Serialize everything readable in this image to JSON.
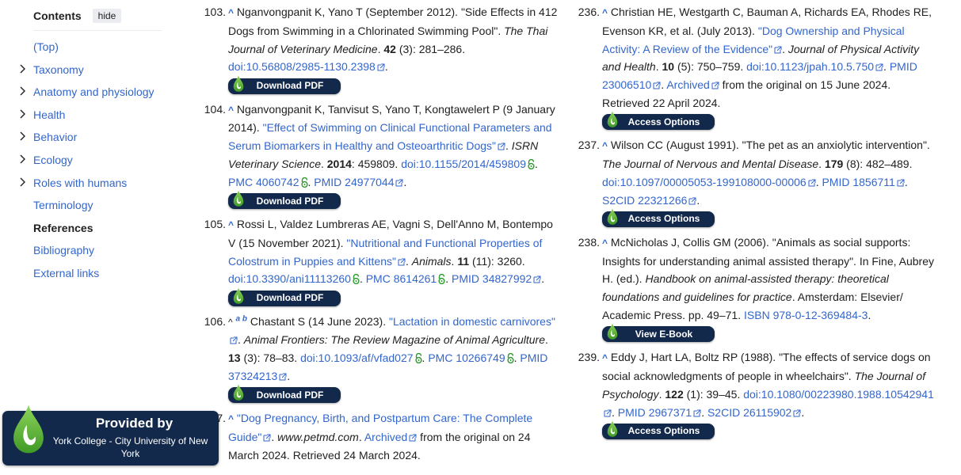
{
  "toc": {
    "title": "Contents",
    "hide_label": "hide",
    "items": [
      {
        "label": "(Top)",
        "expandable": false,
        "active": false
      },
      {
        "label": "Taxonomy",
        "expandable": true,
        "active": false
      },
      {
        "label": "Anatomy and physiology",
        "expandable": true,
        "active": false
      },
      {
        "label": "Health",
        "expandable": true,
        "active": false
      },
      {
        "label": "Behavior",
        "expandable": true,
        "active": false
      },
      {
        "label": "Ecology",
        "expandable": true,
        "active": false
      },
      {
        "label": "Roles with humans",
        "expandable": true,
        "active": false
      },
      {
        "label": "Terminology",
        "expandable": false,
        "active": false
      },
      {
        "label": "References",
        "expandable": false,
        "active": true
      },
      {
        "label": "Bibliography",
        "expandable": false,
        "active": false
      },
      {
        "label": "External links",
        "expandable": false,
        "active": false
      }
    ]
  },
  "references": {
    "r103": {
      "num": "103.",
      "caret": "^",
      "t1": "Nganvongpanit K, Yano T (September 2012). \"Side Effects in 412 Dogs from Swimming in a Chlorinated Swimming Pool\". ",
      "journal": "The Thai Journal of Veterinary Medicine",
      "vol": "42",
      "rest": " (3): 281–286.",
      "doi": "doi:10.56808/2985-1130.2398",
      "button": "Download PDF"
    },
    "r104": {
      "num": "104.",
      "caret": "^",
      "t1": "Nganvongpanit K, Tanvisut S, Yano T, Kongtawelert P (9 January 2014). ",
      "title": "\"Effect of Swimming on Clinical Functional Parameters and Serum Biomarkers in Healthy and Osteoarthritic Dogs\"",
      "journal": "ISRN Veterinary Science",
      "vol": "2014",
      "rest": ": 459809.",
      "doi": "doi:10.1155/2014/459809",
      "pmc": "PMC 4060742",
      "pmid": "PMID 24977044",
      "button": "Download PDF"
    },
    "r105": {
      "num": "105.",
      "caret": "^",
      "t1": "Rossi L, Valdez Lumbreras AE, Vagni S, Dell'Anno M, Bontempo V (15 November 2021). ",
      "title": "\"Nutritional and Functional Properties of Colostrum in Puppies and Kittens\"",
      "journal": "Animals",
      "vol": "11",
      "rest": " (11): 3260.",
      "doi": "doi:10.3390/ani11113260",
      "pmc": "PMC 8614261",
      "pmid": "PMID 34827992",
      "button": "Download PDF"
    },
    "r106": {
      "num": "106.",
      "caret": "^",
      "backlinks": [
        "a",
        "b"
      ],
      "t1": "Chastant S (14 June 2023). ",
      "title": "\"Lactation in domestic carnivores\"",
      "journal": "Animal Frontiers: The Review Magazine of Animal Agriculture",
      "vol": "13",
      "rest": " (3): 78–83.",
      "doi": "doi:10.1093/af/vfad027",
      "pmc": "PMC 10266749",
      "pmid": "PMID 37324213",
      "button": "Download PDF"
    },
    "r107": {
      "num": "107.",
      "caret": "^",
      "title": "\"Dog Pregnancy, Birth, and Postpartum Care: The Complete Guide\"",
      "site": "www.petmd.com",
      "archived": "Archived",
      "rest": " from the original on 24 March 2024. Retrieved 24 March 2024."
    },
    "r236": {
      "num": "236.",
      "caret": "^",
      "t1": "Christian HE, Westgarth C, Bauman A, Richards EA, Rhodes RE, Evenson KR, et al. (July 2013). ",
      "title": "\"Dog Ownership and Physical Activity: A Review of the Evidence\"",
      "journal": "Journal of Physical Activity and Health",
      "vol": "10",
      "rest": " (5): 750–759.",
      "doi": "doi:10.1123/jpah.10.5.750",
      "pmid": "PMID 23006510",
      "archived": "Archived",
      "rest2": " from the original on 15 June 2024. Retrieved 22 April 2024.",
      "button": "Access Options"
    },
    "r237": {
      "num": "237.",
      "caret": "^",
      "t1": "Wilson CC (August 1991). \"The pet as an anxiolytic intervention\". ",
      "journal": "The Journal of Nervous and Mental Disease",
      "vol": "179",
      "rest": " (8): 482–489.",
      "doi": "doi:10.1097/00005053-199108000-00006",
      "pmid": "PMID 1856711",
      "s2cid": "S2CID 22321266",
      "button": "Access Options"
    },
    "r238": {
      "num": "238.",
      "caret": "^",
      "t1": "McNicholas J, Collis GM (2006). \"Animals as social supports: Insights for understanding animal assisted therapy\". In Fine, Aubrey H. (ed.). ",
      "book": "Handbook on animal-assisted therapy: theoretical foundations and guidelines for practice",
      "rest": ". Amsterdam: Elsevier/ Academic Press. pp. 49–71. ",
      "isbn": "ISBN 978-0-12-369484-3",
      "button": "View E-Book"
    },
    "r239": {
      "num": "239.",
      "caret": "^",
      "t1": "Eddy J, Hart LA, Boltz RP (1988). \"The effects of service dogs on social acknowledgments of people in wheelchairs\". ",
      "journal": "The Journal of Psychology",
      "vol": "122",
      "rest": " (1): 39–45.",
      "doi": "doi:10.1080/00223980.1988.10542941",
      "pmid": "PMID 2967371",
      "s2cid": "S2CID 26115902",
      "button": "Access Options"
    }
  },
  "badge": {
    "title": "Provided by",
    "institution": "York College - City University of New York"
  },
  "colors": {
    "link": "#3366cc",
    "text": "#202122",
    "library_navy": "#13294b",
    "drop_green": "#6cc04a",
    "open_access_green": "#2a9a2a"
  }
}
